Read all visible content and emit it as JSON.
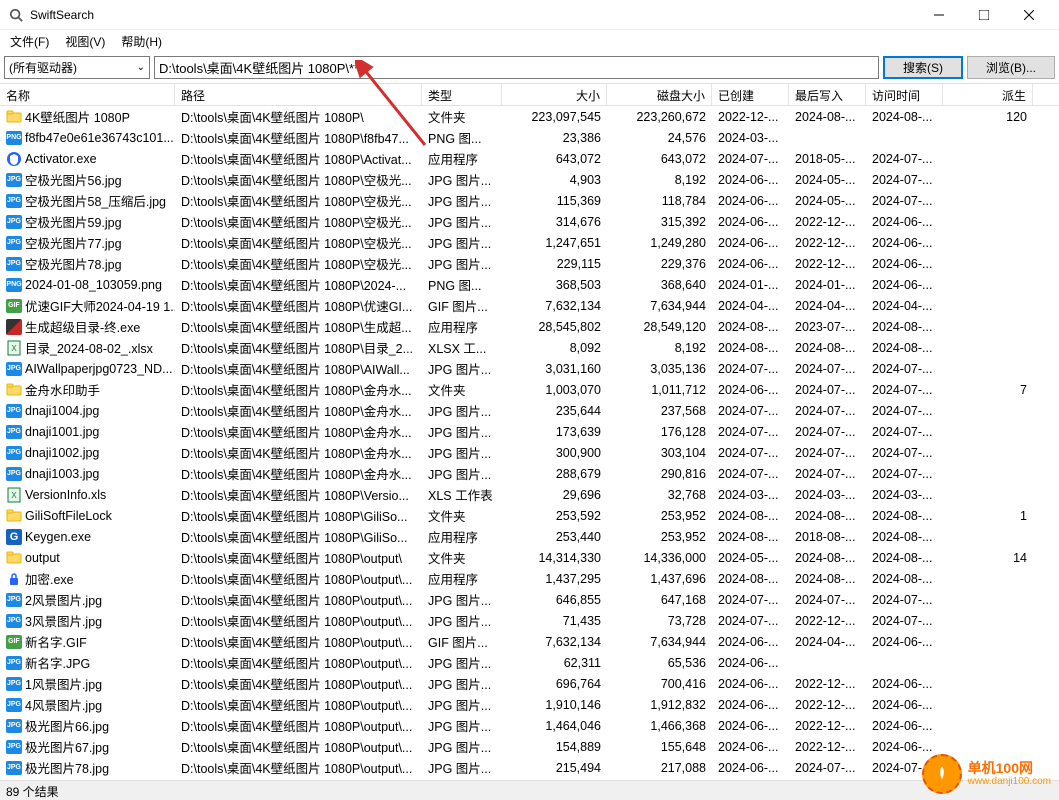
{
  "window": {
    "title": "SwiftSearch"
  },
  "menu": {
    "file": "文件(F)",
    "view": "视图(V)",
    "help": "帮助(H)"
  },
  "toolbar": {
    "drive_select": "(所有驱动器)",
    "path": "D:\\tools\\桌面\\4K壁纸图片 1080P\\**",
    "search": "搜索(S)",
    "browse": "浏览(B)..."
  },
  "columns": {
    "name": "名称",
    "path": "路径",
    "type": "类型",
    "size": "大小",
    "disksize": "磁盘大小",
    "created": "已创建",
    "written": "最后写入",
    "accessed": "访问时间",
    "derived": "派生"
  },
  "rows": [
    {
      "icon": "folder",
      "name": "4K壁纸图片 1080P",
      "path": "D:\\tools\\桌面\\4K壁纸图片 1080P\\",
      "type": "文件夹",
      "size": "223,097,545",
      "disk": "223,260,672",
      "cr": "2022-12-...",
      "wr": "2024-08-...",
      "ac": "2024-08-...",
      "dv": "120"
    },
    {
      "icon": "png",
      "name": "f8fb47e0e61e36743c101...",
      "path": "D:\\tools\\桌面\\4K壁纸图片 1080P\\f8fb47...",
      "type": "PNG 图...",
      "size": "23,386",
      "disk": "24,576",
      "cr": "2024-03-...",
      "wr": "",
      "ac": "",
      "dv": ""
    },
    {
      "icon": "exe-shield",
      "name": "Activator.exe",
      "path": "D:\\tools\\桌面\\4K壁纸图片 1080P\\Activat...",
      "type": "应用程序",
      "size": "643,072",
      "disk": "643,072",
      "cr": "2024-07-...",
      "wr": "2018-05-...",
      "ac": "2024-07-...",
      "dv": ""
    },
    {
      "icon": "jpg",
      "name": "空极光图片56.jpg",
      "path": "D:\\tools\\桌面\\4K壁纸图片 1080P\\空极光...",
      "type": "JPG 图片...",
      "size": "4,903",
      "disk": "8,192",
      "cr": "2024-06-...",
      "wr": "2024-05-...",
      "ac": "2024-07-...",
      "dv": ""
    },
    {
      "icon": "jpg",
      "name": "空极光图片58_压缩后.jpg",
      "path": "D:\\tools\\桌面\\4K壁纸图片 1080P\\空极光...",
      "type": "JPG 图片...",
      "size": "115,369",
      "disk": "118,784",
      "cr": "2024-06-...",
      "wr": "2024-05-...",
      "ac": "2024-07-...",
      "dv": ""
    },
    {
      "icon": "jpg",
      "name": "空极光图片59.jpg",
      "path": "D:\\tools\\桌面\\4K壁纸图片 1080P\\空极光...",
      "type": "JPG 图片...",
      "size": "314,676",
      "disk": "315,392",
      "cr": "2024-06-...",
      "wr": "2022-12-...",
      "ac": "2024-06-...",
      "dv": ""
    },
    {
      "icon": "jpg",
      "name": "空极光图片77.jpg",
      "path": "D:\\tools\\桌面\\4K壁纸图片 1080P\\空极光...",
      "type": "JPG 图片...",
      "size": "1,247,651",
      "disk": "1,249,280",
      "cr": "2024-06-...",
      "wr": "2022-12-...",
      "ac": "2024-06-...",
      "dv": ""
    },
    {
      "icon": "jpg",
      "name": "空极光图片78.jpg",
      "path": "D:\\tools\\桌面\\4K壁纸图片 1080P\\空极光...",
      "type": "JPG 图片...",
      "size": "229,115",
      "disk": "229,376",
      "cr": "2024-06-...",
      "wr": "2022-12-...",
      "ac": "2024-06-...",
      "dv": ""
    },
    {
      "icon": "png",
      "name": "2024-01-08_103059.png",
      "path": "D:\\tools\\桌面\\4K壁纸图片 1080P\\2024-...",
      "type": "PNG 图...",
      "size": "368,503",
      "disk": "368,640",
      "cr": "2024-01-...",
      "wr": "2024-01-...",
      "ac": "2024-06-...",
      "dv": ""
    },
    {
      "icon": "gif",
      "name": "优速GIF大师2024-04-19 1...",
      "path": "D:\\tools\\桌面\\4K壁纸图片 1080P\\优速GI...",
      "type": "GIF 图片...",
      "size": "7,632,134",
      "disk": "7,634,944",
      "cr": "2024-04-...",
      "wr": "2024-04-...",
      "ac": "2024-04-...",
      "dv": ""
    },
    {
      "icon": "redgray",
      "name": "生成超级目录-终.exe",
      "path": "D:\\tools\\桌面\\4K壁纸图片 1080P\\生成超...",
      "type": "应用程序",
      "size": "28,545,802",
      "disk": "28,549,120",
      "cr": "2024-08-...",
      "wr": "2023-07-...",
      "ac": "2024-08-...",
      "dv": ""
    },
    {
      "icon": "xls",
      "name": "目录_2024-08-02_.xlsx",
      "path": "D:\\tools\\桌面\\4K壁纸图片 1080P\\目录_2...",
      "type": "XLSX 工...",
      "size": "8,092",
      "disk": "8,192",
      "cr": "2024-08-...",
      "wr": "2024-08-...",
      "ac": "2024-08-...",
      "dv": ""
    },
    {
      "icon": "jpg",
      "name": "AIWallpaperjpg0723_ND...",
      "path": "D:\\tools\\桌面\\4K壁纸图片 1080P\\AIWall...",
      "type": "JPG 图片...",
      "size": "3,031,160",
      "disk": "3,035,136",
      "cr": "2024-07-...",
      "wr": "2024-07-...",
      "ac": "2024-07-...",
      "dv": ""
    },
    {
      "icon": "folder",
      "name": "金舟水印助手",
      "path": "D:\\tools\\桌面\\4K壁纸图片 1080P\\金舟水...",
      "type": "文件夹",
      "size": "1,003,070",
      "disk": "1,011,712",
      "cr": "2024-06-...",
      "wr": "2024-07-...",
      "ac": "2024-07-...",
      "dv": "7"
    },
    {
      "icon": "jpg",
      "name": "dnaji1004.jpg",
      "path": "D:\\tools\\桌面\\4K壁纸图片 1080P\\金舟水...",
      "type": "JPG 图片...",
      "size": "235,644",
      "disk": "237,568",
      "cr": "2024-07-...",
      "wr": "2024-07-...",
      "ac": "2024-07-...",
      "dv": ""
    },
    {
      "icon": "jpg",
      "name": "dnaji1001.jpg",
      "path": "D:\\tools\\桌面\\4K壁纸图片 1080P\\金舟水...",
      "type": "JPG 图片...",
      "size": "173,639",
      "disk": "176,128",
      "cr": "2024-07-...",
      "wr": "2024-07-...",
      "ac": "2024-07-...",
      "dv": ""
    },
    {
      "icon": "jpg",
      "name": "dnaji1002.jpg",
      "path": "D:\\tools\\桌面\\4K壁纸图片 1080P\\金舟水...",
      "type": "JPG 图片...",
      "size": "300,900",
      "disk": "303,104",
      "cr": "2024-07-...",
      "wr": "2024-07-...",
      "ac": "2024-07-...",
      "dv": ""
    },
    {
      "icon": "jpg",
      "name": "dnaji1003.jpg",
      "path": "D:\\tools\\桌面\\4K壁纸图片 1080P\\金舟水...",
      "type": "JPG 图片...",
      "size": "288,679",
      "disk": "290,816",
      "cr": "2024-07-...",
      "wr": "2024-07-...",
      "ac": "2024-07-...",
      "dv": ""
    },
    {
      "icon": "xls",
      "name": "VersionInfo.xls",
      "path": "D:\\tools\\桌面\\4K壁纸图片 1080P\\Versio...",
      "type": "XLS 工作表",
      "size": "29,696",
      "disk": "32,768",
      "cr": "2024-03-...",
      "wr": "2024-03-...",
      "ac": "2024-03-...",
      "dv": ""
    },
    {
      "icon": "folder",
      "name": "GiliSoftFileLock",
      "path": "D:\\tools\\桌面\\4K壁纸图片 1080P\\GiliSo...",
      "type": "文件夹",
      "size": "253,592",
      "disk": "253,952",
      "cr": "2024-08-...",
      "wr": "2024-08-...",
      "ac": "2024-08-...",
      "dv": "1"
    },
    {
      "icon": "blue-g",
      "name": "Keygen.exe",
      "path": "D:\\tools\\桌面\\4K壁纸图片 1080P\\GiliSo...",
      "type": "应用程序",
      "size": "253,440",
      "disk": "253,952",
      "cr": "2024-08-...",
      "wr": "2018-08-...",
      "ac": "2024-08-...",
      "dv": ""
    },
    {
      "icon": "folder",
      "name": "output",
      "path": "D:\\tools\\桌面\\4K壁纸图片 1080P\\output\\",
      "type": "文件夹",
      "size": "14,314,330",
      "disk": "14,336,000",
      "cr": "2024-05-...",
      "wr": "2024-08-...",
      "ac": "2024-08-...",
      "dv": "14"
    },
    {
      "icon": "lock",
      "name": "加密.exe",
      "path": "D:\\tools\\桌面\\4K壁纸图片 1080P\\output\\...",
      "type": "应用程序",
      "size": "1,437,295",
      "disk": "1,437,696",
      "cr": "2024-08-...",
      "wr": "2024-08-...",
      "ac": "2024-08-...",
      "dv": ""
    },
    {
      "icon": "jpg",
      "name": "2风景图片.jpg",
      "path": "D:\\tools\\桌面\\4K壁纸图片 1080P\\output\\...",
      "type": "JPG 图片...",
      "size": "646,855",
      "disk": "647,168",
      "cr": "2024-07-...",
      "wr": "2024-07-...",
      "ac": "2024-07-...",
      "dv": ""
    },
    {
      "icon": "jpg",
      "name": "3风景图片.jpg",
      "path": "D:\\tools\\桌面\\4K壁纸图片 1080P\\output\\...",
      "type": "JPG 图片...",
      "size": "71,435",
      "disk": "73,728",
      "cr": "2024-07-...",
      "wr": "2022-12-...",
      "ac": "2024-07-...",
      "dv": ""
    },
    {
      "icon": "gif",
      "name": "新名字.GIF",
      "path": "D:\\tools\\桌面\\4K壁纸图片 1080P\\output\\...",
      "type": "GIF 图片...",
      "size": "7,632,134",
      "disk": "7,634,944",
      "cr": "2024-06-...",
      "wr": "2024-04-...",
      "ac": "2024-06-...",
      "dv": ""
    },
    {
      "icon": "jpg",
      "name": "新名字.JPG",
      "path": "D:\\tools\\桌面\\4K壁纸图片 1080P\\output\\...",
      "type": "JPG 图片...",
      "size": "62,311",
      "disk": "65,536",
      "cr": "2024-06-...",
      "wr": "",
      "ac": "",
      "dv": ""
    },
    {
      "icon": "jpg",
      "name": "1风景图片.jpg",
      "path": "D:\\tools\\桌面\\4K壁纸图片 1080P\\output\\...",
      "type": "JPG 图片...",
      "size": "696,764",
      "disk": "700,416",
      "cr": "2024-06-...",
      "wr": "2022-12-...",
      "ac": "2024-06-...",
      "dv": ""
    },
    {
      "icon": "jpg",
      "name": "4风景图片.jpg",
      "path": "D:\\tools\\桌面\\4K壁纸图片 1080P\\output\\...",
      "type": "JPG 图片...",
      "size": "1,910,146",
      "disk": "1,912,832",
      "cr": "2024-06-...",
      "wr": "2022-12-...",
      "ac": "2024-06-...",
      "dv": ""
    },
    {
      "icon": "jpg",
      "name": "极光图片66.jpg",
      "path": "D:\\tools\\桌面\\4K壁纸图片 1080P\\output\\...",
      "type": "JPG 图片...",
      "size": "1,464,046",
      "disk": "1,466,368",
      "cr": "2024-06-...",
      "wr": "2022-12-...",
      "ac": "2024-06-...",
      "dv": ""
    },
    {
      "icon": "jpg",
      "name": "极光图片67.jpg",
      "path": "D:\\tools\\桌面\\4K壁纸图片 1080P\\output\\...",
      "type": "JPG 图片...",
      "size": "154,889",
      "disk": "155,648",
      "cr": "2024-06-...",
      "wr": "2022-12-...",
      "ac": "2024-06-...",
      "dv": ""
    },
    {
      "icon": "jpg",
      "name": "极光图片78.jpg",
      "path": "D:\\tools\\桌面\\4K壁纸图片 1080P\\output\\...",
      "type": "JPG 图片...",
      "size": "215,494",
      "disk": "217,088",
      "cr": "2024-06-...",
      "wr": "2024-07-...",
      "ac": "2024-07-...",
      "dv": ""
    }
  ],
  "status": "89 个结果",
  "watermark": {
    "text": "单机100网",
    "site": "www.danji100.com"
  }
}
